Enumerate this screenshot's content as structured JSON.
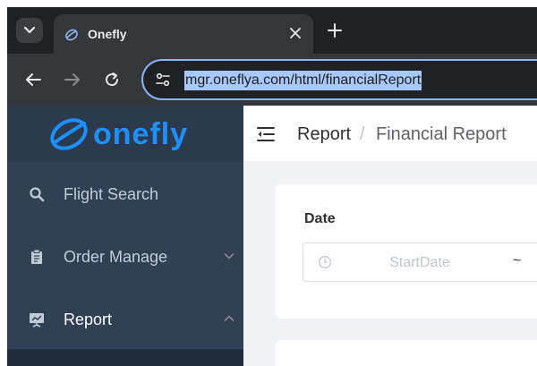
{
  "browser": {
    "tab": {
      "title": "Onefly",
      "favicon": "onefly-logo-icon"
    },
    "url": "mgr.oneflya.com/html/financialReport"
  },
  "sidebar": {
    "logo_text": "onefly",
    "items": [
      {
        "label": "Flight Search",
        "icon": "search-icon"
      },
      {
        "label": "Order Manage",
        "icon": "clipboard-icon",
        "chevron": "chevron-down-icon"
      },
      {
        "label": "Report",
        "icon": "presentation-icon",
        "chevron": "chevron-up-icon"
      }
    ]
  },
  "breadcrumb": {
    "root": "Report",
    "separator": "/",
    "current": "Financial Report"
  },
  "filter": {
    "date_label": "Date",
    "start_placeholder": "StartDate",
    "range_separator": "~"
  },
  "colors": {
    "sidebar_bg": "#304156",
    "brand": "#1e90ff",
    "url_highlight": "#a8c7fa"
  }
}
